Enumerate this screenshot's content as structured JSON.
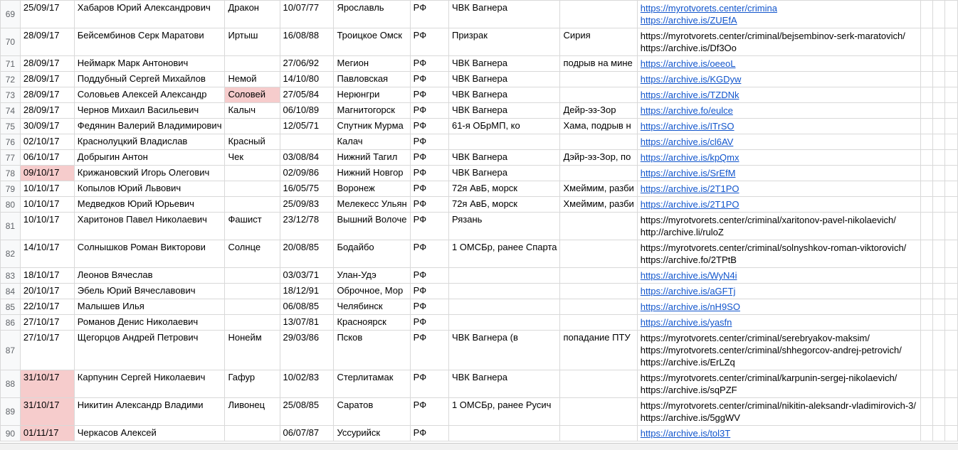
{
  "rows": [
    {
      "n": 69,
      "date": "25/09/17",
      "date_hl": false,
      "name": "Хабаров Юрий Александрович",
      "callsign": "Дракон",
      "cs_hl": false,
      "dob": "10/07/77",
      "place": "Ярославль",
      "country": "РФ",
      "unit": "ЧВК Вагнера",
      "detail": "",
      "links": [
        {
          "t": "https://myrotvorets.center/crimina",
          "u": true
        },
        {
          "t": "https://archive.is/ZUEfA",
          "u": true
        }
      ]
    },
    {
      "n": 70,
      "date": "28/09/17",
      "date_hl": false,
      "name": "Бейсембинов Серк Маратови",
      "callsign": "Иртыш",
      "cs_hl": false,
      "dob": "16/08/88",
      "place": "Троицкое Омск",
      "country": "РФ",
      "unit": "Призрак",
      "detail": "Сирия",
      "links": [
        {
          "t": "https://myrotvorets.center/criminal/bejsembinov-serk-maratovich/",
          "u": false
        },
        {
          "t": "https://archive.is/Df3Oo",
          "u": false
        }
      ]
    },
    {
      "n": 71,
      "date": "28/09/17",
      "date_hl": false,
      "name": "Неймарк Марк Антонович",
      "callsign": "",
      "cs_hl": false,
      "dob": "27/06/92",
      "place": "Мегион",
      "country": "РФ",
      "unit": "ЧВК Вагнера",
      "detail": "подрыв на мине",
      "links": [
        {
          "t": "https://archive.is/oeeoL",
          "u": true
        }
      ]
    },
    {
      "n": 72,
      "date": "28/09/17",
      "date_hl": false,
      "name": "Поддубный Сергей Михайлов",
      "callsign": "Немой",
      "cs_hl": false,
      "dob": "14/10/80",
      "place": "Павловская",
      "country": "РФ",
      "unit": "ЧВК Вагнера",
      "detail": "",
      "links": [
        {
          "t": "https://archive.is/KGDyw",
          "u": true
        }
      ]
    },
    {
      "n": 73,
      "date": "28/09/17",
      "date_hl": false,
      "name": "Соловьев Алексей Александр",
      "callsign": "Соловей",
      "cs_hl": true,
      "dob": "27/05/84",
      "place": "Нерюнгри",
      "country": "РФ",
      "unit": "ЧВК Вагнера",
      "detail": "",
      "links": [
        {
          "t": "https://archive.is/TZDNk",
          "u": true
        }
      ]
    },
    {
      "n": 74,
      "date": "28/09/17",
      "date_hl": false,
      "name": "Чернов Михаил Васильевич",
      "callsign": "Калыч",
      "cs_hl": false,
      "dob": "06/10/89",
      "place": "Магнитогорск",
      "country": "РФ",
      "unit": "ЧВК Вагнера",
      "detail": "Дейр-эз-Зор",
      "links": [
        {
          "t": "https://archive.fo/eulce",
          "u": true
        }
      ]
    },
    {
      "n": 75,
      "date": "30/09/17",
      "date_hl": false,
      "name": "Федянин Валерий Владимирович",
      "callsign": "",
      "cs_hl": false,
      "dob": "12/05/71",
      "place": "Спутник Мурма",
      "country": "РФ",
      "unit": "61-я ОБрМП, ко",
      "detail": "Хама, подрыв н",
      "links": [
        {
          "t": "https://archive.is/ITrSO",
          "u": true
        }
      ]
    },
    {
      "n": 76,
      "date": "02/10/17",
      "date_hl": false,
      "name": "Краснолуцкий Владислав",
      "callsign": "Красный",
      "cs_hl": false,
      "dob": "",
      "place": "Калач",
      "country": "РФ",
      "unit": "",
      "detail": "",
      "links": [
        {
          "t": "https://archive.is/cl6AV",
          "u": true
        }
      ]
    },
    {
      "n": 77,
      "date": "06/10/17",
      "date_hl": false,
      "name": "Добрыгин Антон",
      "callsign": "Чек",
      "cs_hl": false,
      "dob": "03/08/84",
      "place": "Нижний Тагил",
      "country": "РФ",
      "unit": "ЧВК Вагнера",
      "detail": "Дэйр-эз-Зор, по",
      "links": [
        {
          "t": "https://archive.is/kpQmx",
          "u": true
        }
      ]
    },
    {
      "n": 78,
      "date": "09/10/17",
      "date_hl": true,
      "name": "Крижановский Игорь Олегович",
      "callsign": "",
      "cs_hl": false,
      "dob": "02/09/86",
      "place": "Нижний Новгор",
      "country": "РФ",
      "unit": "ЧВК Вагнера",
      "detail": "",
      "links": [
        {
          "t": "https://archive.is/SrEfM",
          "u": true
        }
      ]
    },
    {
      "n": 79,
      "date": "10/10/17",
      "date_hl": false,
      "name": "Копылов Юрий Львович",
      "callsign": "",
      "cs_hl": false,
      "dob": "16/05/75",
      "place": "Воронеж",
      "country": "РФ",
      "unit": "72я АвБ, морск",
      "detail": "Хмеймим, разби",
      "links": [
        {
          "t": "https://archive.is/2T1PO",
          "u": true
        }
      ]
    },
    {
      "n": 80,
      "date": "10/10/17",
      "date_hl": false,
      "name": "Медведков Юрий Юрьевич",
      "callsign": "",
      "cs_hl": false,
      "dob": "25/09/83",
      "place": "Мелекесс Ульян",
      "country": "РФ",
      "unit": "72я АвБ, морск",
      "detail": "Хмеймим, разби",
      "links": [
        {
          "t": "https://archive.is/2T1PO",
          "u": true
        }
      ]
    },
    {
      "n": 81,
      "date": "10/10/17",
      "date_hl": false,
      "name": "Харитонов Павел Николаевич",
      "callsign": "Фашист",
      "cs_hl": false,
      "dob": "23/12/78",
      "place": "Вышний Волоче",
      "country": "РФ",
      "unit": "Рязань",
      "detail": "",
      "links": [
        {
          "t": "https://myrotvorets.center/criminal/xaritonov-pavel-nikolaevich/",
          "u": false
        },
        {
          "t": "http://archive.li/ruloZ",
          "u": false
        }
      ]
    },
    {
      "n": 82,
      "date": "14/10/17",
      "date_hl": false,
      "name": "Солнышков Роман Викторови",
      "callsign": "Солнце",
      "cs_hl": false,
      "dob": "20/08/85",
      "place": "Бодайбо",
      "country": "РФ",
      "unit": "1 ОМСБр, ранее Спарта",
      "detail": "",
      "links": [
        {
          "t": "https://myrotvorets.center/criminal/solnyshkov-roman-viktorovich/",
          "u": false
        },
        {
          "t": "https://archive.fo/2TPtB",
          "u": false
        }
      ]
    },
    {
      "n": 83,
      "date": "18/10/17",
      "date_hl": false,
      "name": "Леонов Вячеслав",
      "callsign": "",
      "cs_hl": false,
      "dob": "03/03/71",
      "place": "Улан-Удэ",
      "country": "РФ",
      "unit": "",
      "detail": "",
      "links": [
        {
          "t": "https://archive.is/WyN4i",
          "u": true
        }
      ]
    },
    {
      "n": 84,
      "date": "20/10/17",
      "date_hl": false,
      "name": "Эбель Юрий Вячеславович",
      "callsign": "",
      "cs_hl": false,
      "dob": "18/12/91",
      "place": "Оброчное, Мор",
      "country": "РФ",
      "unit": "",
      "detail": "",
      "links": [
        {
          "t": "https://archive.is/aGFTj",
          "u": true
        }
      ]
    },
    {
      "n": 85,
      "date": "22/10/17",
      "date_hl": false,
      "name": "Малышев Илья",
      "callsign": "",
      "cs_hl": false,
      "dob": "06/08/85",
      "place": "Челябинск",
      "country": "РФ",
      "unit": "",
      "detail": "",
      "links": [
        {
          "t": "https://archive.is/nH9SO",
          "u": true
        }
      ]
    },
    {
      "n": 86,
      "date": "27/10/17",
      "date_hl": false,
      "name": "Романов Денис Николаевич",
      "callsign": "",
      "cs_hl": false,
      "dob": "13/07/81",
      "place": "Красноярск",
      "country": "РФ",
      "unit": "",
      "detail": "",
      "links": [
        {
          "t": "https://archive.is/yasfn",
          "u": true
        }
      ]
    },
    {
      "n": 87,
      "date": "27/10/17",
      "date_hl": false,
      "name": "Щегорцов Андрей Петрович",
      "callsign": "Нонейм",
      "cs_hl": false,
      "dob": "29/03/86",
      "place": "Псков",
      "country": "РФ",
      "unit": "ЧВК Вагнера (в",
      "detail": "попадание ПТУ",
      "links": [
        {
          "t": "https://myrotvorets.center/criminal/serebryakov-maksim/",
          "u": false
        },
        {
          "t": "https://myrotvorets.center/criminal/shhegorcov-andrej-petrovich/",
          "u": false
        },
        {
          "t": "https://archive.is/ErLZq",
          "u": false
        }
      ]
    },
    {
      "n": 88,
      "date": "31/10/17",
      "date_hl": true,
      "name": "Карпунин Сергей Николаевич",
      "callsign": "Гафур",
      "cs_hl": false,
      "dob": "10/02/83",
      "place": "Стерлитамак",
      "country": "РФ",
      "unit": "ЧВК Вагнера",
      "detail": "",
      "links": [
        {
          "t": "https://myrotvorets.center/criminal/karpunin-sergej-nikolaevich/",
          "u": false
        },
        {
          "t": "https://archive.is/sqPZF",
          "u": false
        }
      ]
    },
    {
      "n": 89,
      "date": "31/10/17",
      "date_hl": true,
      "name": "Никитин Александр Владими",
      "callsign": "Ливонец",
      "cs_hl": false,
      "dob": "25/08/85",
      "place": "Саратов",
      "country": "РФ",
      "unit": "1 ОМСБр, ранее Русич",
      "detail": "",
      "links": [
        {
          "t": "https://myrotvorets.center/criminal/nikitin-aleksandr-vladimirovich-3/",
          "u": false
        },
        {
          "t": "https://archive.is/5ggWV",
          "u": false
        }
      ]
    },
    {
      "n": 90,
      "date": "01/11/17",
      "date_hl": true,
      "name": "Черкасов Алексей",
      "callsign": "",
      "cs_hl": false,
      "dob": "06/07/87",
      "place": "Уссурийск",
      "country": "РФ",
      "unit": "",
      "detail": "",
      "links": [
        {
          "t": "https://archive.is/tol3T",
          "u": true
        }
      ]
    }
  ]
}
